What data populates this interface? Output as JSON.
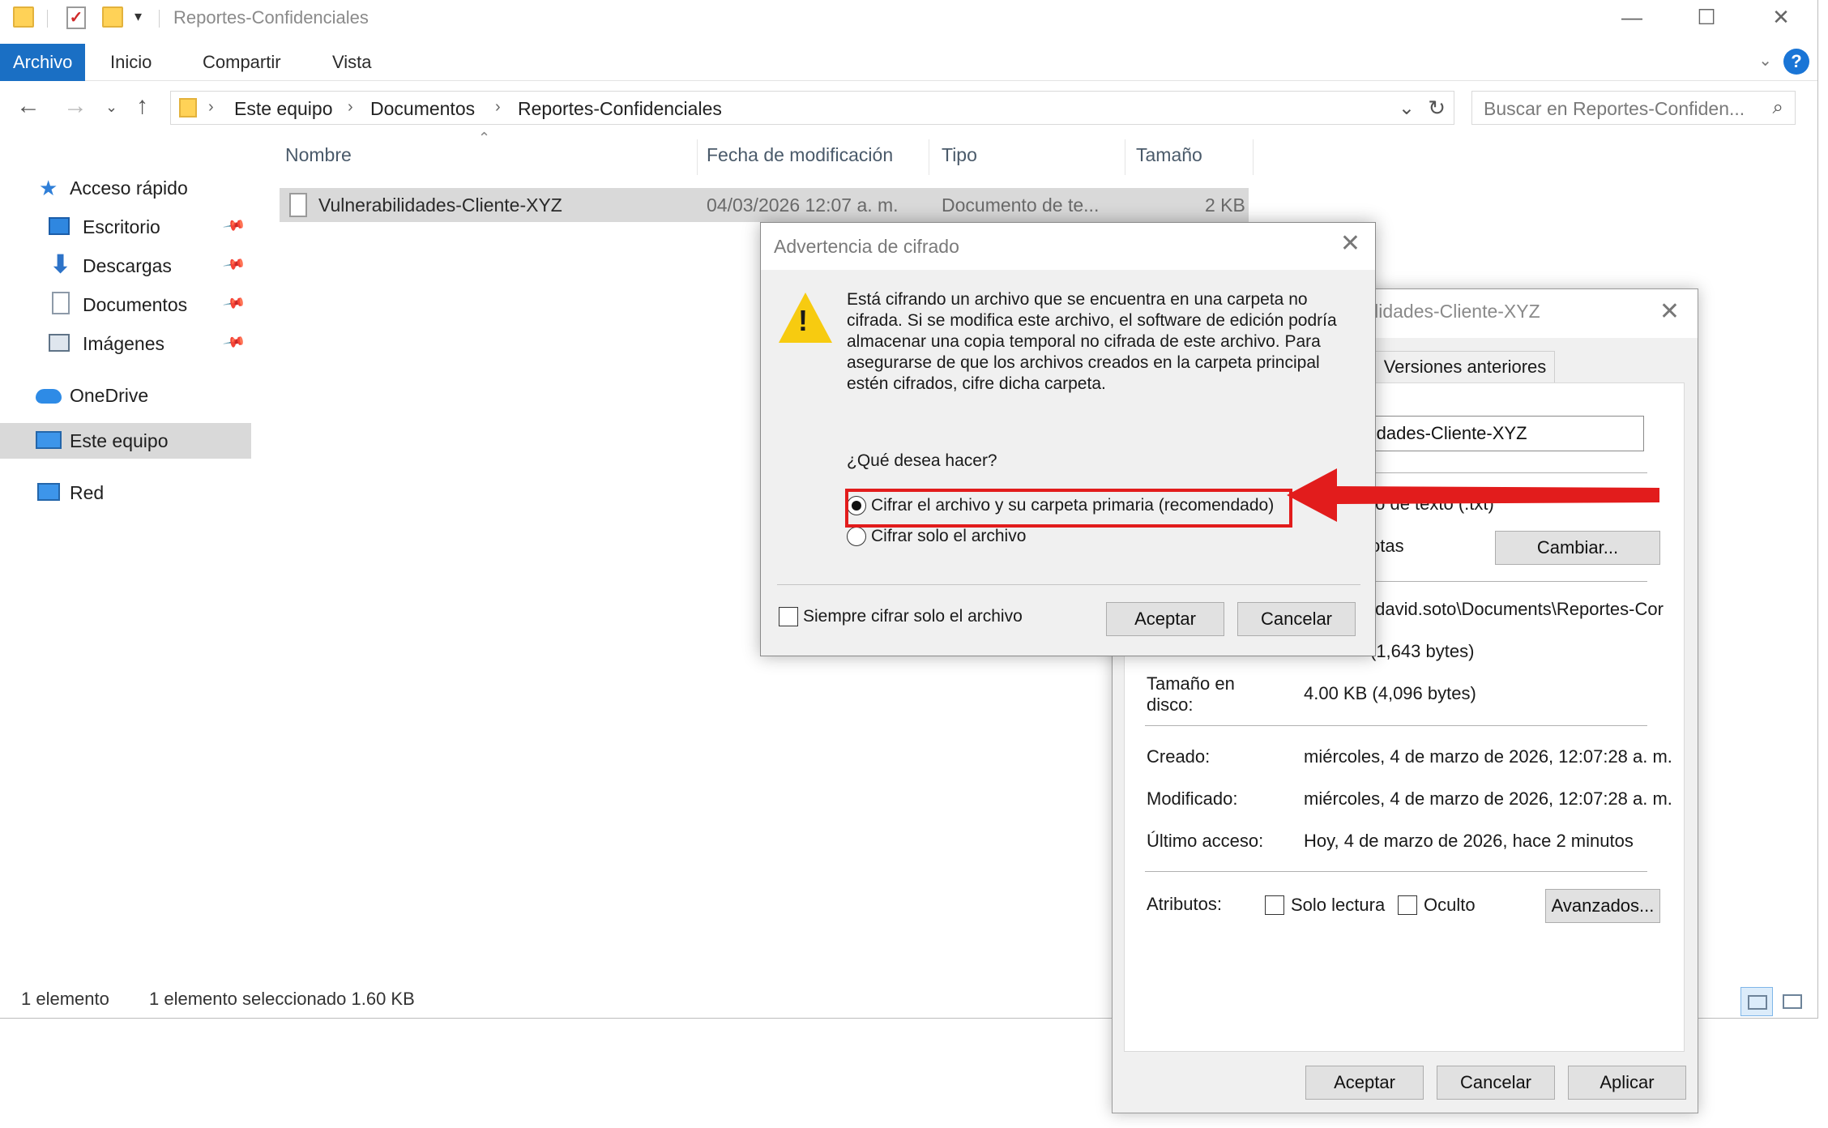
{
  "explorer": {
    "window_title": "Reportes-Confidenciales",
    "qa_dropdown": "▾",
    "ribbon_tabs": [
      "Archivo",
      "Inicio",
      "Compartir",
      "Vista"
    ],
    "breadcrumb": [
      "Este equipo",
      "Documentos",
      "Reportes-Confidenciales"
    ],
    "search_placeholder": "Buscar en Reportes-Confiden...",
    "sidebar": {
      "quick_access": "Acceso rápido",
      "items": [
        "Escritorio",
        "Descargas",
        "Documentos",
        "Imágenes"
      ],
      "onedrive": "OneDrive",
      "this_pc": "Este equipo",
      "network": "Red"
    },
    "columns": {
      "name": "Nombre",
      "modified": "Fecha de modificación",
      "type": "Tipo",
      "size": "Tamaño"
    },
    "file": {
      "name": "Vulnerabilidades-Cliente-XYZ",
      "modified": "04/03/2026 12:07 a. m.",
      "type": "Documento de te...",
      "size": "2 KB"
    },
    "status": {
      "count": "1 elemento",
      "selection": "1 elemento seleccionado  1.60 KB"
    }
  },
  "properties_dialog": {
    "title_partial": "ilidades-Cliente-XYZ",
    "tab_previous_versions": "Versiones anteriores",
    "name_value": "ilidades-Cliente-XYZ",
    "type_partial": "to de texto (.txt)",
    "opens_with_partial": "otas",
    "change_button": "Cambiar...",
    "location_partial": "\\david.soto\\Documents\\Reportes-Cor",
    "size_partial": "(1,643 bytes)",
    "size_on_disk_label": "Tamaño en disco:",
    "size_on_disk_value": "4.00 KB (4,096 bytes)",
    "created_label": "Creado:",
    "created_value": "miércoles, 4 de marzo de 2026, 12:07:28 a. m.",
    "modified_label": "Modificado:",
    "modified_value": "miércoles, 4 de marzo de 2026, 12:07:28 a. m.",
    "accessed_label": "Último acceso:",
    "accessed_value": "Hoy, 4 de marzo de 2026, hace 2 minutos",
    "attributes_label": "Atributos:",
    "readonly_label": "Solo lectura",
    "hidden_label": "Oculto",
    "advanced_button": "Avanzados...",
    "ok_button": "Aceptar",
    "cancel_button": "Cancelar",
    "apply_button": "Aplicar"
  },
  "warning_dialog": {
    "title": "Advertencia de cifrado",
    "message": "Está cifrando un archivo que se encuentra en una carpeta no cifrada. Si se modifica este archivo, el software de edición podría almacenar una copia temporal no cifrada de este archivo. Para asegurarse de que los archivos creados en la carpeta principal estén cifrados, cifre dicha carpeta.",
    "question": "¿Qué desea hacer?",
    "option_folder": "Cifrar el archivo y su carpeta primaria (recomendado)",
    "option_file": "Cifrar solo el archivo",
    "selected_option": "option_folder",
    "always_checkbox": "Siempre cifrar solo el archivo",
    "ok_button": "Aceptar",
    "cancel_button": "Cancelar"
  },
  "annotation": {
    "highlight_color": "#e21c1c"
  }
}
